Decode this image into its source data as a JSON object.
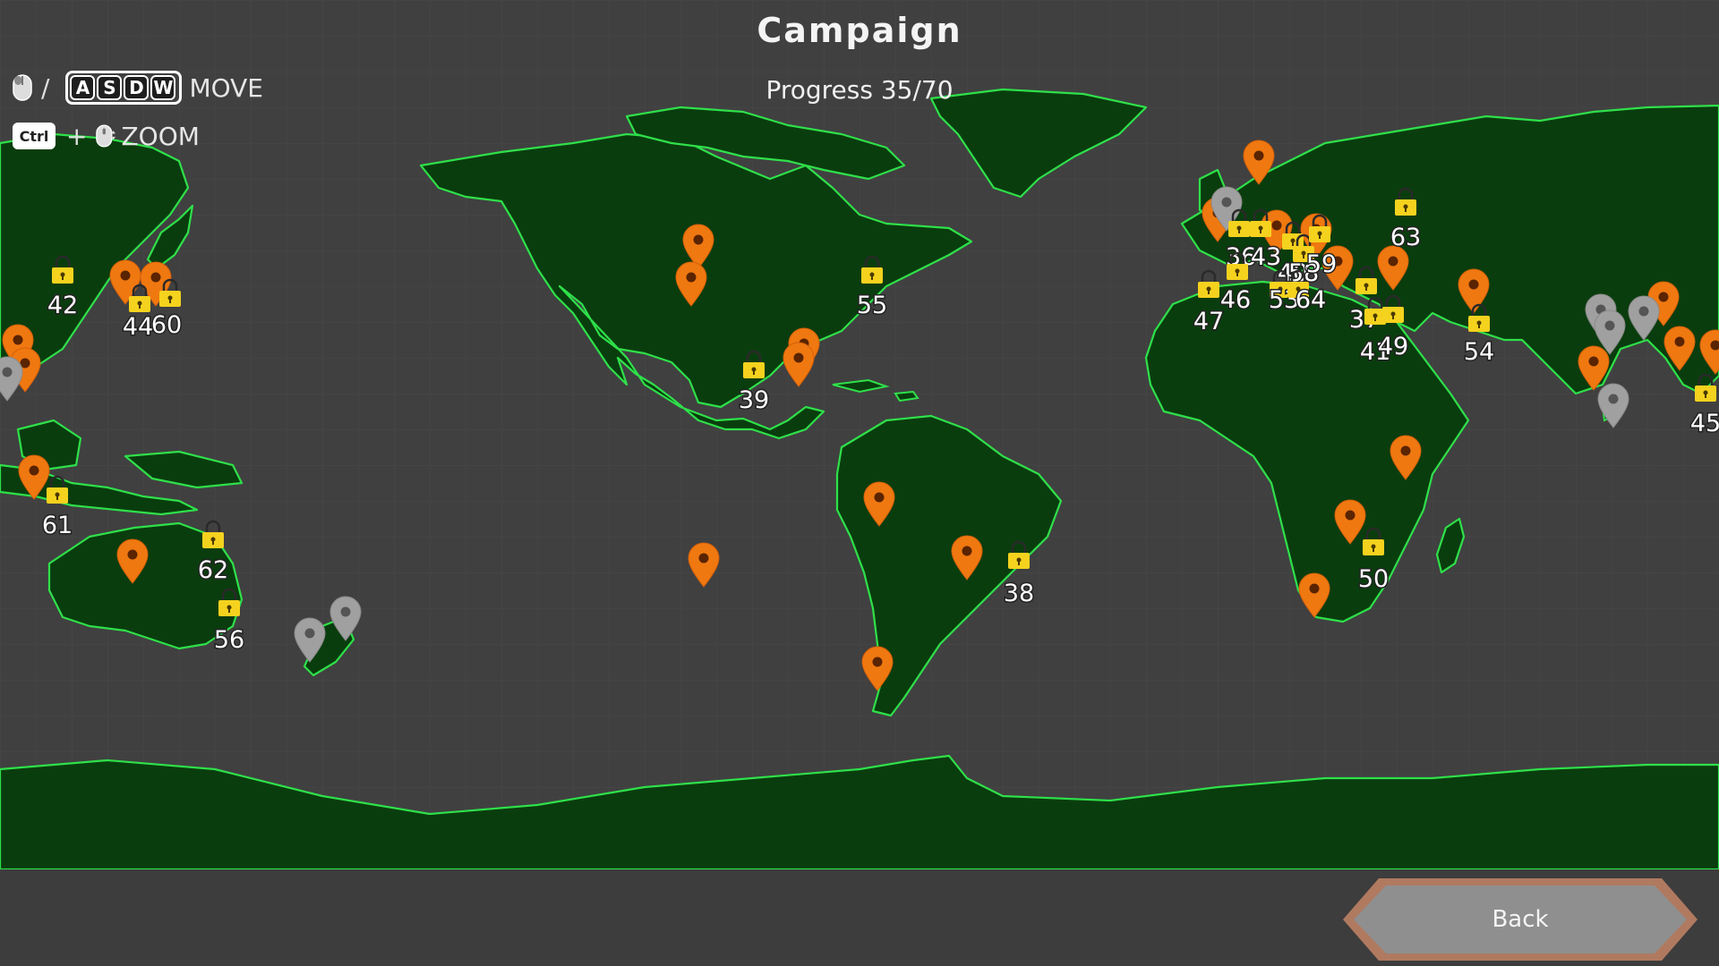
{
  "header": {
    "title": "Campaign",
    "progress_text": "Progress 35/70"
  },
  "controls": {
    "move": {
      "separator": "/",
      "keys": [
        "A",
        "S",
        "D",
        "W"
      ],
      "label": "MOVE",
      "mouse_icon": "mouse-icon"
    },
    "zoom": {
      "modifier_key": "Ctrl",
      "plus": "+",
      "label": "ZOOM",
      "mouse_icon": "mouse-scroll-icon"
    }
  },
  "back_button": {
    "label": "Back"
  },
  "colors": {
    "background": "#404040",
    "land": "#0a3d0e",
    "coast": "#2fe04a",
    "marker_active": "#f07810",
    "marker_inactive": "#9a9a9a",
    "lock": "#f5d21e"
  },
  "locked_levels": [
    {
      "number": "42"
    },
    {
      "number": "44"
    },
    {
      "number": "60"
    },
    {
      "number": "61"
    },
    {
      "number": "62"
    },
    {
      "number": "56"
    },
    {
      "number": "55"
    },
    {
      "number": "39"
    },
    {
      "number": "38"
    },
    {
      "number": "63"
    },
    {
      "number": "36"
    },
    {
      "number": "43"
    },
    {
      "number": "40"
    },
    {
      "number": "58"
    },
    {
      "number": "59"
    },
    {
      "number": "46"
    },
    {
      "number": "53"
    },
    {
      "number": "64"
    },
    {
      "number": "47"
    },
    {
      "number": "37"
    },
    {
      "number": "41"
    },
    {
      "number": "49"
    },
    {
      "number": "54"
    },
    {
      "number": "50"
    },
    {
      "number": "45"
    }
  ],
  "markers": {
    "active_icon": "map-pin-icon",
    "inactive_icon": "map-pin-grey-icon",
    "lock_icon": "padlock-icon"
  }
}
